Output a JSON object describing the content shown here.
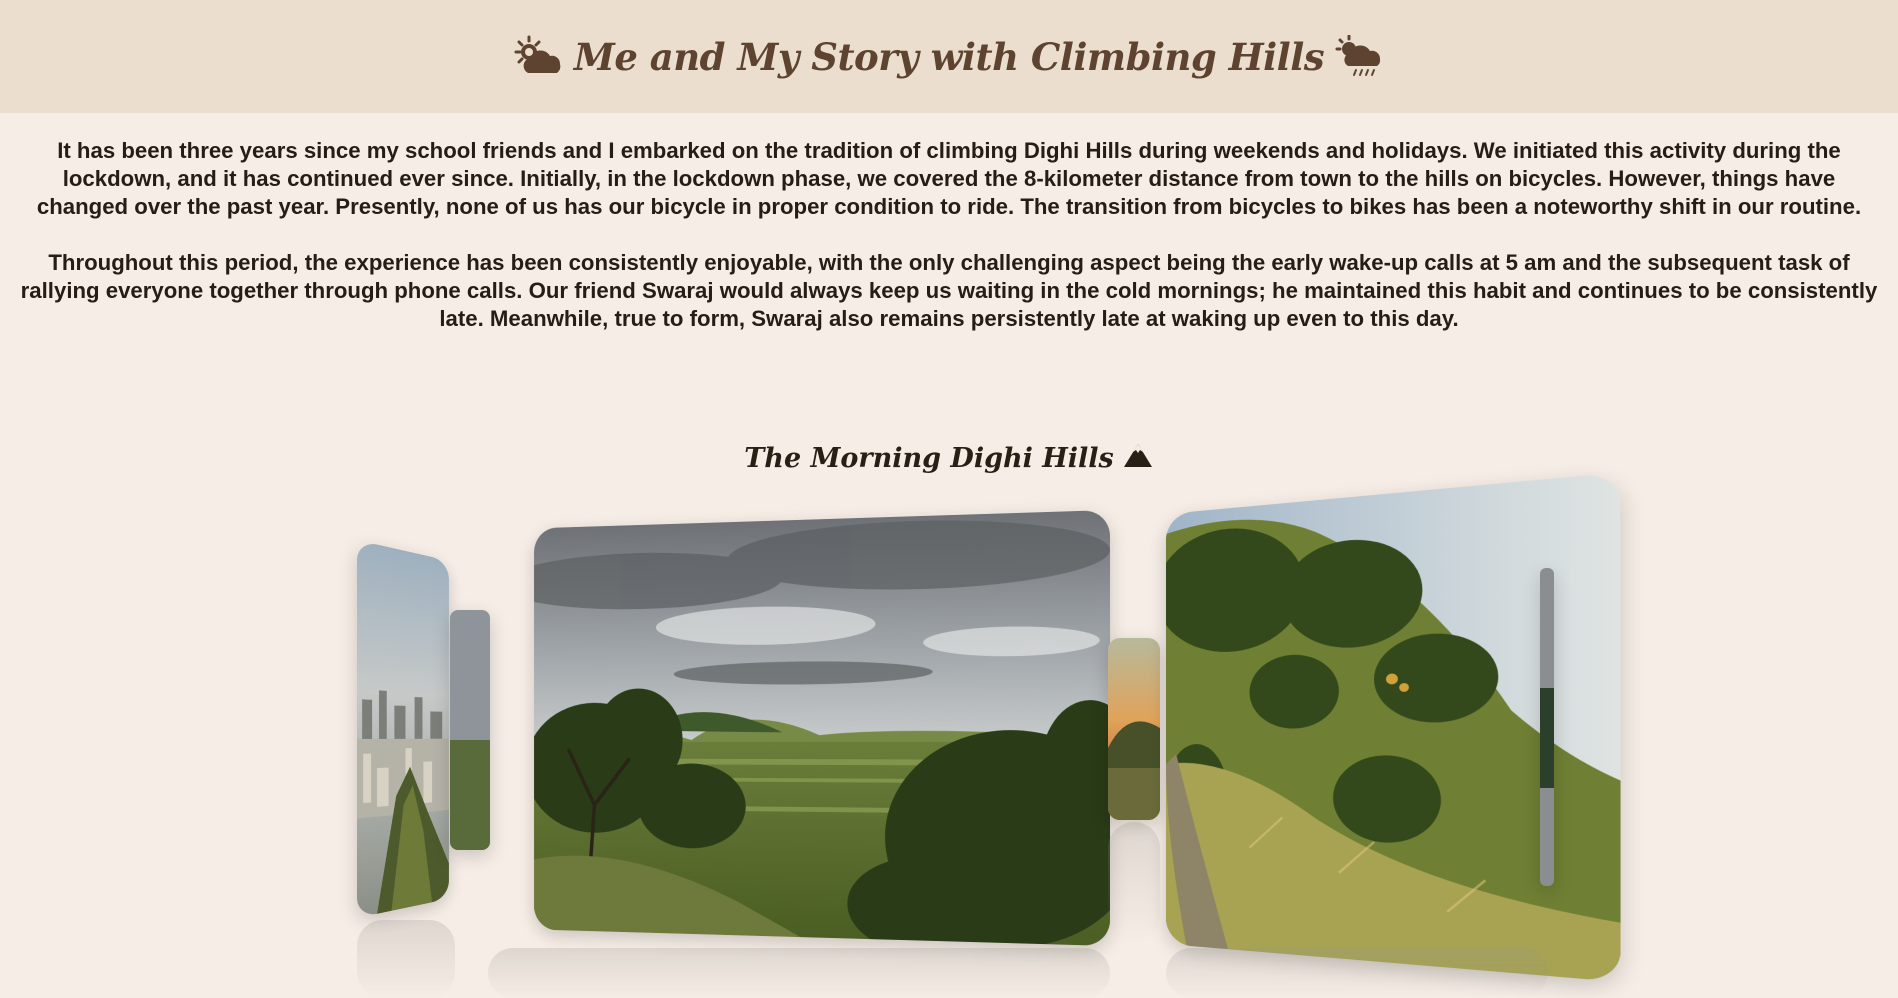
{
  "header": {
    "title": "Me and My Story with Climbing Hills",
    "left_icon": "sun-behind-cloud-icon",
    "right_icon": "cloud-with-rain-icon"
  },
  "story": {
    "paragraph_1": "It has been three years since my school friends and I embarked on the tradition of climbing Dighi Hills during weekends and holidays. We initiated this activity during the lockdown, and it has continued ever since. Initially, in the lockdown phase, we covered the 8-kilometer distance from town to the hills on bicycles. However, things have changed over the past year. Presently, none of us has our bicycle in proper condition to ride. The transition from bicycles to bikes has been a noteworthy shift in our routine.",
    "paragraph_2": "Throughout this period, the experience has been consistently enjoyable, with the only challenging aspect being the early wake-up calls at 5 am and the subsequent task of rallying everyone together through phone calls. Our friend Swaraj would always keep us waiting in the cold mornings; he maintained this habit and continues to be consistently late. Meanwhile, true to form, Swaraj also remains persistently late at waking up even to this day."
  },
  "gallery": {
    "title": "The Morning Dighi Hills",
    "title_icon": "mountain-icon",
    "photos": [
      {
        "name": "city-view-photo",
        "subject": "city below hill in morning haze"
      },
      {
        "name": "valley-view-photo",
        "subject": "green valley under cloudy sky"
      },
      {
        "name": "sunrise-photo",
        "subject": "sunrise over hill"
      },
      {
        "name": "hill-slope-photo",
        "subject": "grassy hill slope with trail"
      }
    ]
  },
  "colors": {
    "header_bg": "#ebdecf",
    "page_bg": "#f6ede6",
    "title_text": "#5e4430"
  }
}
